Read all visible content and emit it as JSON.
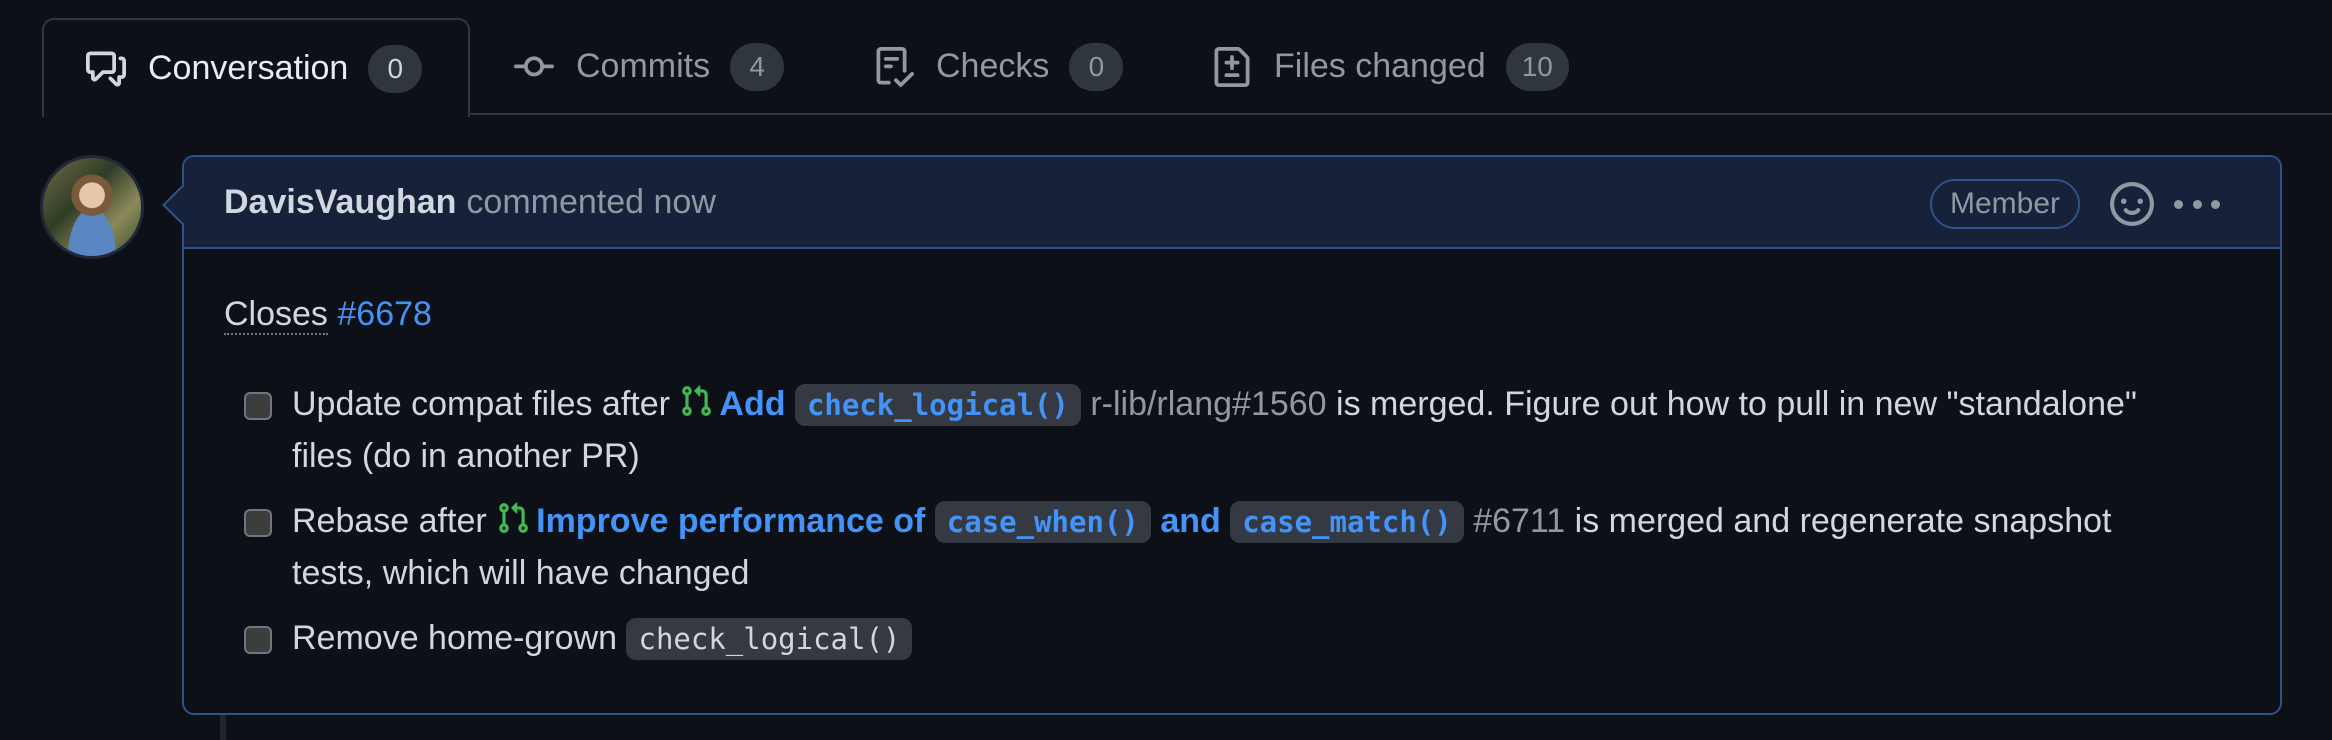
{
  "tabs": [
    {
      "label": "Conversation",
      "count": "0",
      "icon": "comment-discussion-icon",
      "active": true
    },
    {
      "label": "Commits",
      "count": "4",
      "icon": "git-commit-icon",
      "active": false
    },
    {
      "label": "Checks",
      "count": "0",
      "icon": "checklist-icon",
      "active": false
    },
    {
      "label": "Files changed",
      "count": "10",
      "icon": "file-diff-icon",
      "active": false
    }
  ],
  "comment": {
    "author": "DavisVaughan",
    "action": "commented now",
    "role_badge": "Member",
    "avatar_alt": "DavisVaughan avatar",
    "closes_label": "Closes",
    "closes_issue": "#6678",
    "tasks": [
      {
        "checked": false,
        "prefix": "Update compat files after",
        "pr_title_prefix": "Add",
        "pr_code": "check_logical()",
        "pr_ref": "r-lib/rlang#1560",
        "suffix": "is merged. Figure out how to pull in new \"standalone\" files (do in another PR)"
      },
      {
        "checked": false,
        "prefix": "Rebase after",
        "pr_title_prefix": "Improve performance of",
        "pr_code_1": "case_when()",
        "pr_title_mid": "and",
        "pr_code_2": "case_match()",
        "pr_ref": "#6711",
        "suffix": "is merged and regenerate snapshot tests, which will have changed"
      },
      {
        "checked": false,
        "prefix": "Remove home-grown",
        "code": "check_logical()"
      }
    ]
  },
  "colors": {
    "background": "#0d1117",
    "accent_link": "#4493f8",
    "header_bg": "#172139",
    "border_highlight": "#2f5288",
    "pr_open_green": "#3fb950"
  }
}
